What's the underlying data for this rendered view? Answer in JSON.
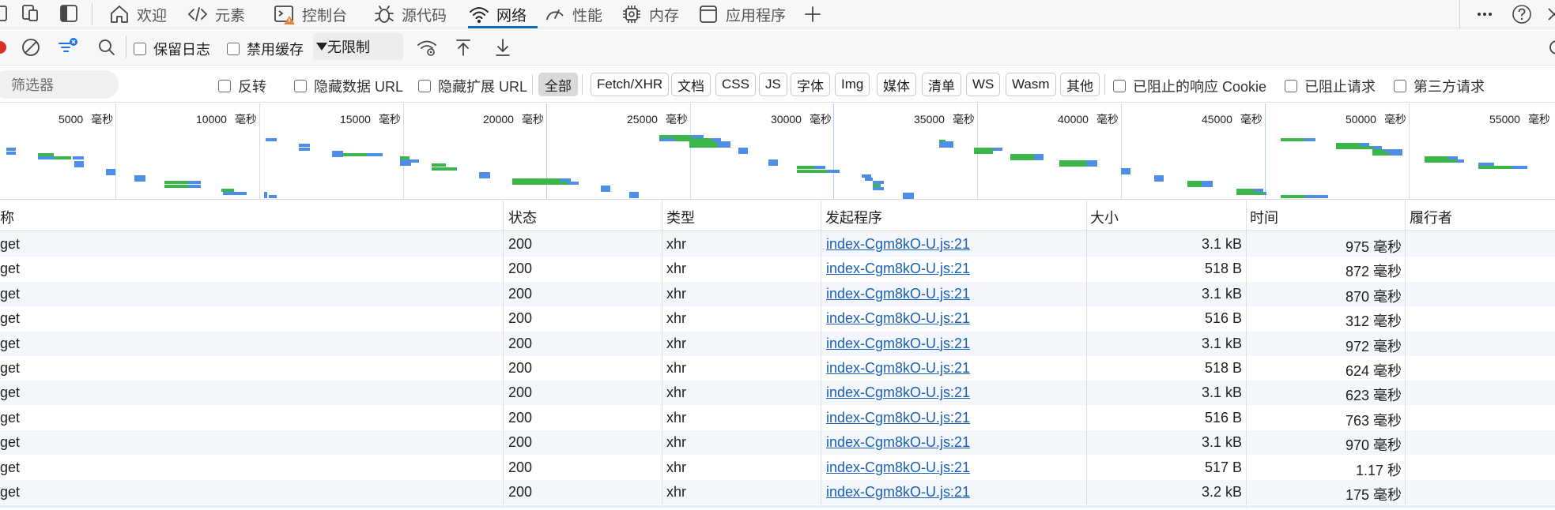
{
  "tabs": [
    {
      "label": "欢迎",
      "icon": "home-icon"
    },
    {
      "label": "元素",
      "icon": "code-icon"
    },
    {
      "label": "控制台",
      "icon": "console-warning-icon"
    },
    {
      "label": "源代码",
      "icon": "bug-icon"
    },
    {
      "label": "网络",
      "icon": "wifi-icon",
      "active": true
    },
    {
      "label": "性能",
      "icon": "performance-icon"
    },
    {
      "label": "内存",
      "icon": "memory-chip-icon"
    },
    {
      "label": "应用程序",
      "icon": "application-icon"
    }
  ],
  "toolbar": {
    "preserve_log": "保留日志",
    "disable_cache": "禁用缓存",
    "throttling": "无限制"
  },
  "filter": {
    "placeholder": "筛选器",
    "invert": "反转",
    "hide_data_urls": "隐藏数据 URL",
    "hide_extension_urls": "隐藏扩展 URL",
    "types": [
      "全部",
      "Fetch/XHR",
      "文档",
      "CSS",
      "JS",
      "字体",
      "Img",
      "媒体",
      "清单",
      "WS",
      "Wasm",
      "其他"
    ],
    "selected_type": "全部",
    "blocked_cookies": "已阻止的响应 Cookie",
    "blocked_requests": "已阻止请求",
    "third_party": "第三方请求"
  },
  "overview": {
    "ticks": [
      "5000",
      "10000",
      "15000",
      "20000",
      "25000",
      "30000",
      "35000",
      "40000",
      "45000",
      "50000",
      "55000"
    ],
    "unit": "毫秒",
    "colors": {
      "waiting": "#3cb64a",
      "download": "#4f8ee8"
    }
  },
  "table": {
    "headers": {
      "name": "称",
      "status": "状态",
      "type": "类型",
      "initiator": "发起程序",
      "size": "大小",
      "time": "时间",
      "fulfilled_by": "履行者"
    },
    "rows": [
      {
        "name": "get",
        "status": "200",
        "type": "xhr",
        "initiator": "index-Cgm8kO-U.js:21",
        "size": "3.1 kB",
        "time": "975 毫秒"
      },
      {
        "name": "get",
        "status": "200",
        "type": "xhr",
        "initiator": "index-Cgm8kO-U.js:21",
        "size": "518 B",
        "time": "872 毫秒"
      },
      {
        "name": "get",
        "status": "200",
        "type": "xhr",
        "initiator": "index-Cgm8kO-U.js:21",
        "size": "3.1 kB",
        "time": "870 毫秒"
      },
      {
        "name": "get",
        "status": "200",
        "type": "xhr",
        "initiator": "index-Cgm8kO-U.js:21",
        "size": "516 B",
        "time": "312 毫秒"
      },
      {
        "name": "get",
        "status": "200",
        "type": "xhr",
        "initiator": "index-Cgm8kO-U.js:21",
        "size": "3.1 kB",
        "time": "972 毫秒"
      },
      {
        "name": "get",
        "status": "200",
        "type": "xhr",
        "initiator": "index-Cgm8kO-U.js:21",
        "size": "518 B",
        "time": "624 毫秒"
      },
      {
        "name": "get",
        "status": "200",
        "type": "xhr",
        "initiator": "index-Cgm8kO-U.js:21",
        "size": "3.1 kB",
        "time": "623 毫秒"
      },
      {
        "name": "get",
        "status": "200",
        "type": "xhr",
        "initiator": "index-Cgm8kO-U.js:21",
        "size": "516 B",
        "time": "763 毫秒"
      },
      {
        "name": "get",
        "status": "200",
        "type": "xhr",
        "initiator": "index-Cgm8kO-U.js:21",
        "size": "3.1 kB",
        "time": "970 毫秒"
      },
      {
        "name": "get",
        "status": "200",
        "type": "xhr",
        "initiator": "index-Cgm8kO-U.js:21",
        "size": "517 B",
        "time": "1.17 秒"
      },
      {
        "name": "get",
        "status": "200",
        "type": "xhr",
        "initiator": "index-Cgm8kO-U.js:21",
        "size": "3.2 kB",
        "time": "175 毫秒"
      }
    ]
  }
}
